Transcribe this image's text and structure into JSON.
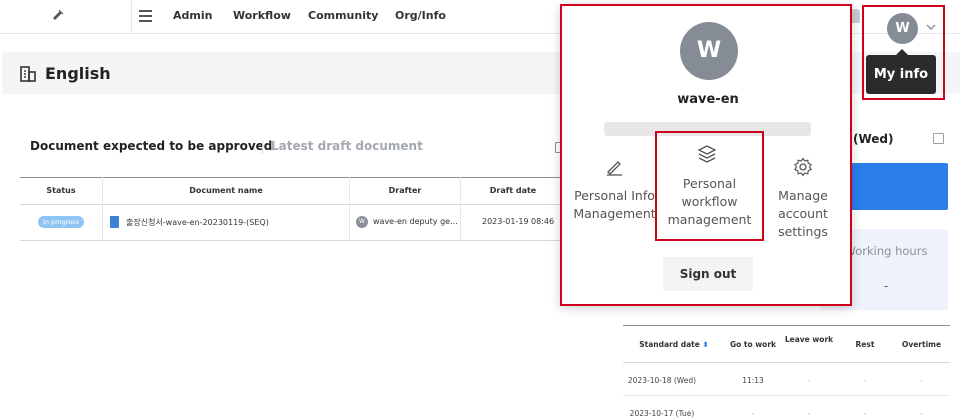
{
  "nav": {
    "items": [
      "Admin",
      "Workflow",
      "Community",
      "Org/Info"
    ]
  },
  "header": {
    "title": "English"
  },
  "tabs": {
    "active": "Document expected to be approved",
    "inactive": "Latest draft document"
  },
  "doc_table": {
    "headers": [
      "Status",
      "Document name",
      "Drafter",
      "Draft date"
    ],
    "rows": [
      {
        "status": "In progress",
        "name": "출장신청서-wave-en-20230119-(SEQ)",
        "drafter_initial": "W",
        "drafter": "wave-en deputy ge...",
        "date": "2023-01-19 08:46"
      }
    ]
  },
  "attendance": {
    "day_label": "(Wed)",
    "hours_label": "Working hours",
    "hours_value": "-",
    "headers": [
      "Standard date",
      "Go to work",
      "Leave work",
      "Rest",
      "Overtime"
    ],
    "rows": [
      {
        "date": "2023-10-18 (Wed)",
        "go": "11:13",
        "leave": "-",
        "rest": "-",
        "overtime": "-"
      },
      {
        "date": "2023-10-17 (Tue)",
        "go": "-",
        "leave": "-",
        "rest": "-",
        "overtime": "-"
      }
    ]
  },
  "user": {
    "initial": "W",
    "name": "wave-en",
    "tooltip": "My info"
  },
  "popup": {
    "menu": [
      {
        "icon": "pencil-icon",
        "label": "Personal Info Management"
      },
      {
        "icon": "layers-icon",
        "label": "Personal workflow management"
      },
      {
        "icon": "gear-icon",
        "label": "Manage account settings"
      }
    ],
    "signout": "Sign out"
  },
  "colors": {
    "accent": "#2b7de9",
    "highlight": "#d0021b",
    "badge": "#8ec5f5"
  }
}
